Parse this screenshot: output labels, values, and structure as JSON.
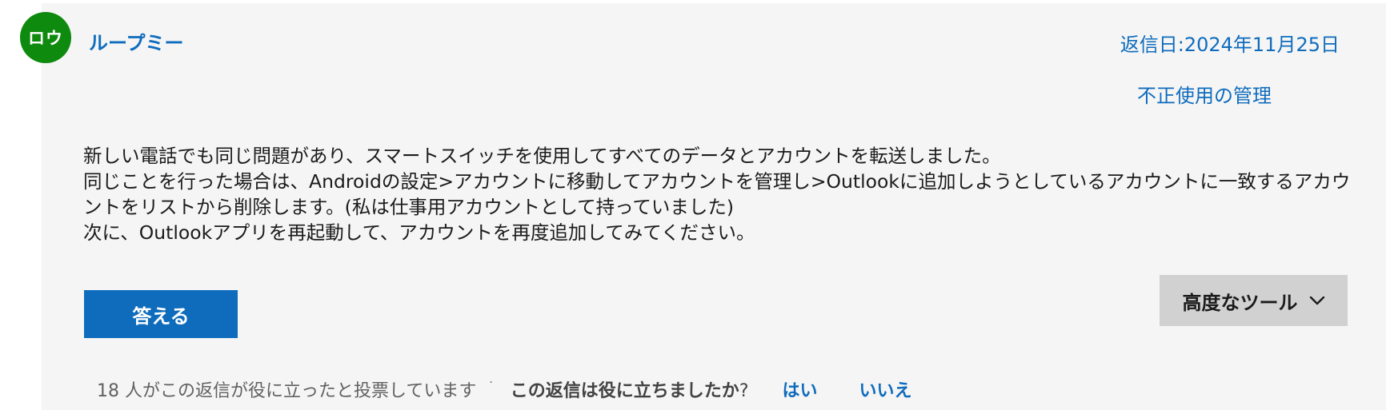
{
  "author": {
    "avatar_initials": "ロウ",
    "avatar_color": "#0e8a0e",
    "name": "ループミー"
  },
  "meta": {
    "reply_date": "返信日:2024年11月25日",
    "manage_abuse": "不正使用の管理"
  },
  "body": {
    "line1": "新しい電話でも同じ問題があり、スマートスイッチを使用してすべてのデータとアカウントを転送しました。",
    "line2": "同じことを行った場合は、Androidの設定>アカウントに移動してアカウントを管理し>Outlookに追加しようとしているアカウントに一致するアカウントをリストから削除します。(私は仕事用アカウントとして持っていました)",
    "line3": "次に、Outlookアプリを再起動して、アカウントを再度追加してみてください。"
  },
  "actions": {
    "answer_label": "答える",
    "advanced_tools_label": "高度なツール",
    "advanced_tools_icon": "chevron-down-icon"
  },
  "footer": {
    "vote_count_text": "18 人がこの返信が役に立ったと投票しています",
    "separator": "·",
    "question": "この返信は役に立ちましたか",
    "question_mark": "?",
    "yes": "はい",
    "no": "いいえ"
  },
  "colors": {
    "link": "#0f6cbd",
    "card_background": "#f5f5f5",
    "primary_button": "#0f6cbd",
    "secondary_button": "#d1d1d1"
  }
}
